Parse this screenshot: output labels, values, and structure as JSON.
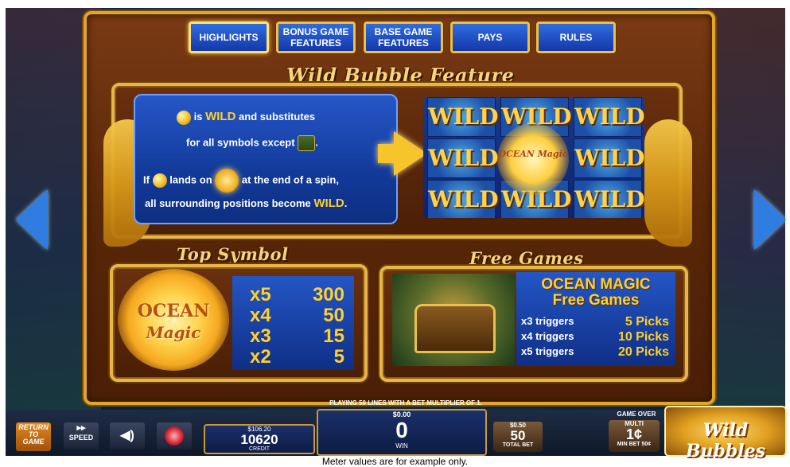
{
  "tabs": [
    {
      "label": "HIGHLIGHTS",
      "active": true
    },
    {
      "label": "BONUS GAME\nFEATURES",
      "active": false
    },
    {
      "label": "BASE GAME\nFEATURES",
      "active": false
    },
    {
      "label": "PAYS",
      "active": false
    },
    {
      "label": "RULES",
      "active": false
    }
  ],
  "wild_feature": {
    "title": "Wild Bubble Feature",
    "line1_a": "is",
    "line1_wild": "WILD",
    "line1_b": "and substitutes",
    "line2": "for all symbols except",
    "line2_end": ".",
    "line3_if": "If",
    "line3_a": "lands on",
    "line3_b": "at the end of a spin,",
    "line4_a": "all surrounding positions become",
    "line4_wild": "WILD",
    "line4_end": ".",
    "grid_word": "WILD",
    "center_badge": "OCEAN Magic"
  },
  "top_symbol": {
    "title": "Top Symbol",
    "symbol_line1": "OCEAN",
    "symbol_line2": "Magic",
    "pays": [
      {
        "mult": "x5",
        "value": "300"
      },
      {
        "mult": "x4",
        "value": "50"
      },
      {
        "mult": "x3",
        "value": "15"
      },
      {
        "mult": "x2",
        "value": "5"
      }
    ]
  },
  "free_games": {
    "title": "Free Games",
    "heading1": "OCEAN MAGIC",
    "heading2": "Free Games",
    "rows": [
      {
        "trigger": "x3 triggers",
        "picks": "5 Picks"
      },
      {
        "trigger": "x4 triggers",
        "picks": "10 Picks"
      },
      {
        "trigger": "x5 triggers",
        "picks": "20 Picks"
      }
    ]
  },
  "bottom_bar": {
    "lines_message": "PLAYING 50 LINES WITH A BET MULTIPLIER OF 1.",
    "return_label": "RETURN\nTO\nGAME",
    "speed_label": "SPEED",
    "credit_dollars": "$106.20",
    "credit_value": "10620",
    "credit_label": "CREDIT",
    "win_dollars": "$0.00",
    "win_value": "0",
    "win_label": "WIN",
    "bet_dollars": "$0.50",
    "bet_value": "50",
    "bet_label": "TOTAL BET",
    "game_over": "GAME OVER",
    "denom_multi": "MULTI",
    "denom_value": "1¢",
    "min_bet": "MIN BET 50¢",
    "logo": "Wild Bubbles"
  },
  "footnote": "Meter values are for example only.",
  "colors": {
    "gold": "#e7b548",
    "panel_blue": "#1437a8",
    "wild_yellow": "#ffd02a",
    "frame_brown": "#5a2708"
  }
}
